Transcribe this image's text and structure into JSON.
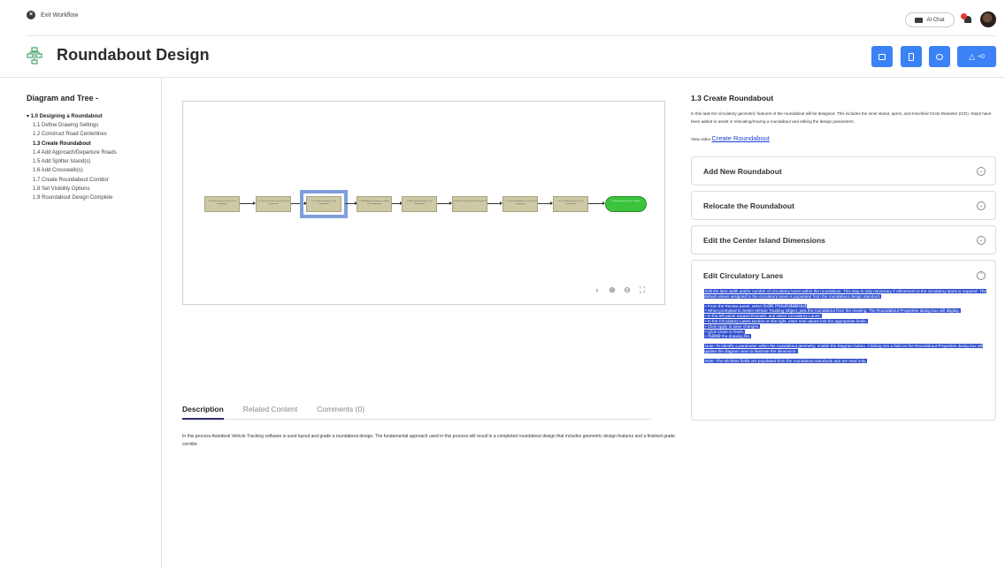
{
  "topbar": {
    "exit_label": "Exit Workflow",
    "ai_chat_label": "AI Chat"
  },
  "header": {
    "title": "Roundabout Design",
    "reaction_count": "+0"
  },
  "sidebar": {
    "title": "Diagram and Tree -",
    "root": "▾ 1.0 Designing a Roundabout",
    "items": [
      "1.1 Define Drawing Settings",
      "1.2 Construct Road Centerlines",
      "1.3 Create Roundabout",
      "1.4 Add Approach/Departure Roads",
      "1.5 Add Splitter Island(s)",
      "1.6 Add Crosswalk(s)",
      "1.7 Create Roundabout Corridor",
      "1.8 Set Visibility Options",
      "1.9 Roundabout Design Complete"
    ]
  },
  "diagram": {
    "steps": [
      "1.1 Define Drawing Settings (Civil Integration)",
      "1.2 Construct Road Centerlines (Civil Integration)",
      "1.3 Create Roundabout (Civil Integration)",
      "1.4 Add Approach/Departure Roads (Civil Integration)",
      "1.5 Add Splitter Island(s) (Civil Integration)",
      "1.6 Add Crosswalk(s) (Civil Integration)",
      "1.7 Create Roundabout Corridor (Civil Integration)",
      "1.8 Set Visibility Options (Civil Integration)",
      "1.9 Roundabout Design Complete"
    ],
    "controls": [
      "‹",
      "⊕",
      "⊖",
      "⛶"
    ]
  },
  "tabs": [
    "Description",
    "Related Content",
    "Comments (0)"
  ],
  "description": "In this process Autodesk Vehicle Tracking software is used layout and grade a roundabout design.  The fundamental approach used in this process will result in a completed roundabout design that includes geometric design features and a finished grade corridor.",
  "right_panel": {
    "title": "1.3 Create Roundabout",
    "text": "In this task the circulatory geometric features of the roundabout will be designed.  This includes the inner island, apron, and Inscribed Circle Diameter (ICD).  Steps have been added to assist in relocating/moving a roundabout and editing the design parameters.",
    "video_prefix": "View video",
    "video_link": "Create Roundabout",
    "accordions": [
      "Add New Roundabout",
      "Relocate the Roundabout",
      "Edit the Center Island Dimensions",
      "Edit Circulatory Lanes"
    ],
    "open_body": {
      "intro": "Edit the lane width and/or number of circulatory lanes within the roundabout.  This step is only necessary if refinement to the circulatory lanes is required.  The default values assigned to the circulatory lanes is populated from the roundabout design standard.",
      "step1_prefix": "From the Review panel, select",
      "step1_link": "Edit Roundabout",
      "step2": "When prompted to Select Vehicle Tracking Object, pick the roundabout from the drawing.  The Roundabout Properties dialog box will display.",
      "step3": "In the left panel expand Roundel, and select Circulatory Lanes.",
      "step4": "In the Circulatory Lanes section on the right, enter new values into the appropriate fields.",
      "step5": "Click Apply to save changes.",
      "step6": "Click Close to finish.",
      "step7_link": "Save",
      "step7_suffix": "the drawing file.",
      "note1": "Note: To identify a parameter within the roundabout geometry, enable the Diagram button.  Clicking into a field on the Roundabout Properties dialog box will update the diagram view to illustrate the dimension.",
      "note2": "Note: The Min/Max fields are populated from the roundabout standards and are read only."
    }
  },
  "colors": {
    "accent": "#3b82f6",
    "step_fill": "#cdc9a5",
    "end_fill": "#3cc43c",
    "highlight": "#2f4fcf"
  }
}
